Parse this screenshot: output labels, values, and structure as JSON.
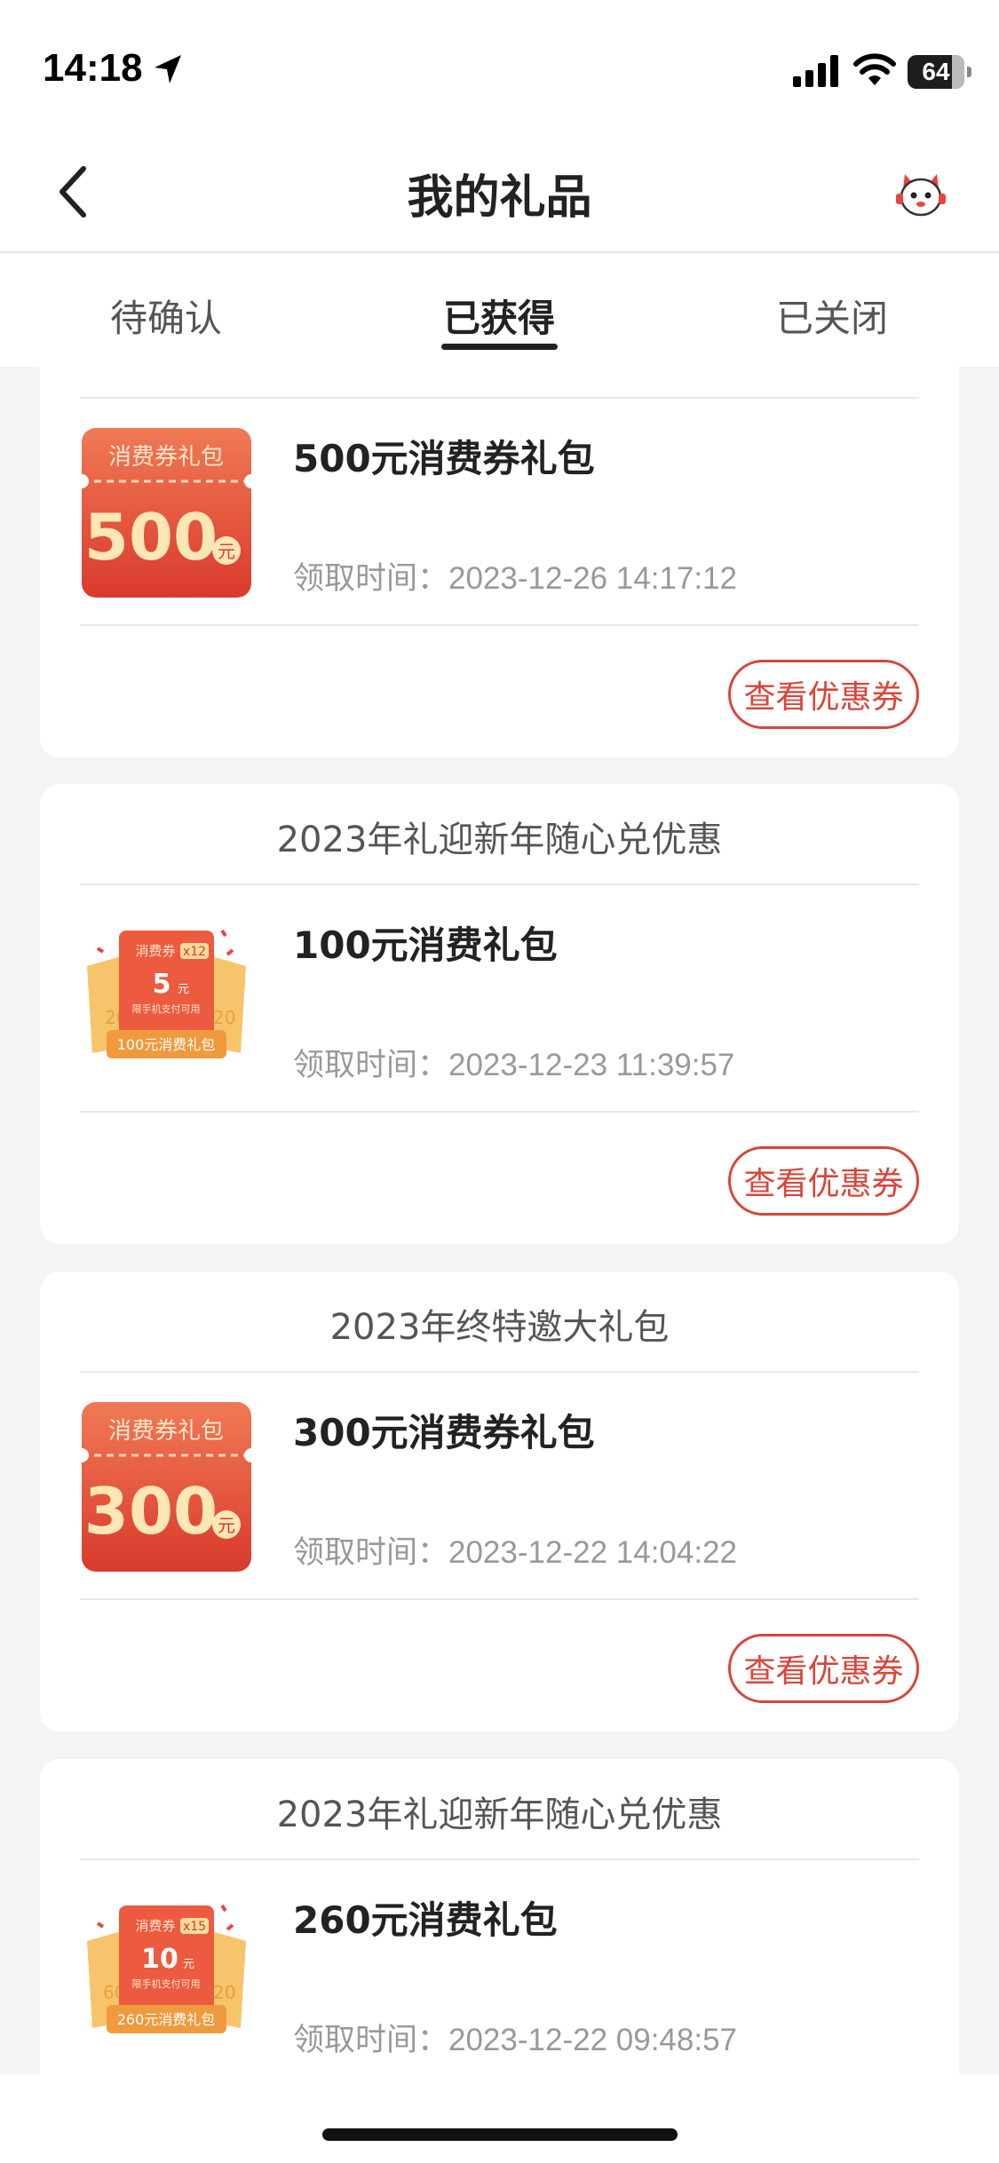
{
  "status_bar": {
    "time": "14:18",
    "battery": "64"
  },
  "header": {
    "title": "我的礼品"
  },
  "tabs": [
    {
      "label": "待确认",
      "active": false
    },
    {
      "label": "已获得",
      "active": true
    },
    {
      "label": "已关闭",
      "active": false
    }
  ],
  "gifts": [
    {
      "title": "",
      "name": "500元消费券礼包",
      "time": "领取时间：2023-12-26 14:17:12",
      "button": "查看优惠券",
      "image": {
        "kind": "voucher",
        "top_text": "消费券礼包",
        "amount": "500",
        "unit": "元"
      }
    },
    {
      "title": "2023年礼迎新年随心兑优惠",
      "name": "100元消费礼包",
      "time": "领取时间：2023-12-23 11:39:57",
      "button": "查看优惠券",
      "image": {
        "kind": "bundle",
        "tag": "消费券",
        "count": "x12",
        "amount": "5",
        "unit": "元",
        "note": "限手机支付可用",
        "label": "100元消费礼包",
        "side_left": "20",
        "side_right": "20"
      }
    },
    {
      "title": "2023年终特邀大礼包",
      "name": "300元消费券礼包",
      "time": "领取时间：2023-12-22 14:04:22",
      "button": "查看优惠券",
      "image": {
        "kind": "voucher",
        "top_text": "消费券礼包",
        "amount": "300",
        "unit": "元"
      }
    },
    {
      "title": "2023年礼迎新年随心兑优惠",
      "name": "260元消费礼包",
      "time": "领取时间：2023-12-22 09:48:57",
      "button": "",
      "image": {
        "kind": "bundle",
        "tag": "消费券",
        "count": "x15",
        "amount": "10",
        "unit": "元",
        "note": "限手机支付可用",
        "label": "260元消费礼包",
        "side_left": "60",
        "side_right": "20"
      }
    }
  ],
  "colors": {
    "accent": "#d8453a",
    "voucher_top": "#ee6a4a",
    "voucher_bottom": "#e0402f",
    "gold": "#f5c76a"
  }
}
